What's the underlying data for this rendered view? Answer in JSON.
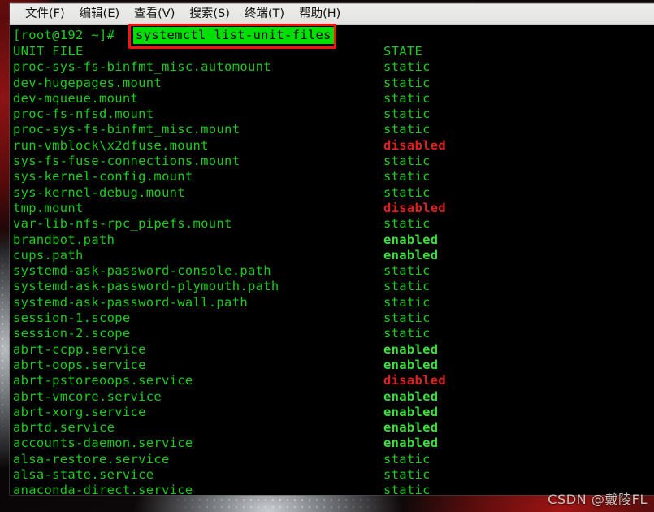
{
  "window": {
    "menubar": [
      {
        "label": "文件(F)",
        "name": "menu-file"
      },
      {
        "label": "编辑(E)",
        "name": "menu-edit"
      },
      {
        "label": "查看(V)",
        "name": "menu-view"
      },
      {
        "label": "搜索(S)",
        "name": "menu-search"
      },
      {
        "label": "终端(T)",
        "name": "menu-terminal"
      },
      {
        "label": "帮助(H)",
        "name": "menu-help"
      }
    ]
  },
  "terminal": {
    "prompt": "[root@192 ~]# ",
    "command": "systemctl list-unit-files",
    "header": {
      "unit": "UNIT FILE",
      "state": "STATE"
    },
    "rows": [
      {
        "unit": "proc-sys-fs-binfmt_misc.automount",
        "state": "static"
      },
      {
        "unit": "dev-hugepages.mount",
        "state": "static"
      },
      {
        "unit": "dev-mqueue.mount",
        "state": "static"
      },
      {
        "unit": "proc-fs-nfsd.mount",
        "state": "static"
      },
      {
        "unit": "proc-sys-fs-binfmt_misc.mount",
        "state": "static"
      },
      {
        "unit": "run-vmblock\\x2dfuse.mount",
        "state": "disabled"
      },
      {
        "unit": "sys-fs-fuse-connections.mount",
        "state": "static"
      },
      {
        "unit": "sys-kernel-config.mount",
        "state": "static"
      },
      {
        "unit": "sys-kernel-debug.mount",
        "state": "static"
      },
      {
        "unit": "tmp.mount",
        "state": "disabled"
      },
      {
        "unit": "var-lib-nfs-rpc_pipefs.mount",
        "state": "static"
      },
      {
        "unit": "brandbot.path",
        "state": "enabled"
      },
      {
        "unit": "cups.path",
        "state": "enabled"
      },
      {
        "unit": "systemd-ask-password-console.path",
        "state": "static"
      },
      {
        "unit": "systemd-ask-password-plymouth.path",
        "state": "static"
      },
      {
        "unit": "systemd-ask-password-wall.path",
        "state": "static"
      },
      {
        "unit": "session-1.scope",
        "state": "static"
      },
      {
        "unit": "session-2.scope",
        "state": "static"
      },
      {
        "unit": "abrt-ccpp.service",
        "state": "enabled"
      },
      {
        "unit": "abrt-oops.service",
        "state": "enabled"
      },
      {
        "unit": "abrt-pstoreoops.service",
        "state": "disabled"
      },
      {
        "unit": "abrt-vmcore.service",
        "state": "enabled"
      },
      {
        "unit": "abrt-xorg.service",
        "state": "enabled"
      },
      {
        "unit": "abrtd.service",
        "state": "enabled"
      },
      {
        "unit": "accounts-daemon.service",
        "state": "enabled"
      },
      {
        "unit": "alsa-restore.service",
        "state": "static"
      },
      {
        "unit": "alsa-state.service",
        "state": "static"
      },
      {
        "unit": "anaconda-direct.service",
        "state": "static"
      }
    ]
  },
  "annotation": {
    "highlight_command": "systemctl list-unit-files",
    "box_color": "#f41414",
    "highlight_bg": "#00e000"
  },
  "watermark": {
    "text": "CSDN @戴陵FL"
  },
  "colors": {
    "terminal_bg": "#000000",
    "text_green": "#1ccc1c",
    "enabled_green": "#3ce03c",
    "disabled_red": "#e02020",
    "menubar_bg": "#e8e8e6"
  }
}
